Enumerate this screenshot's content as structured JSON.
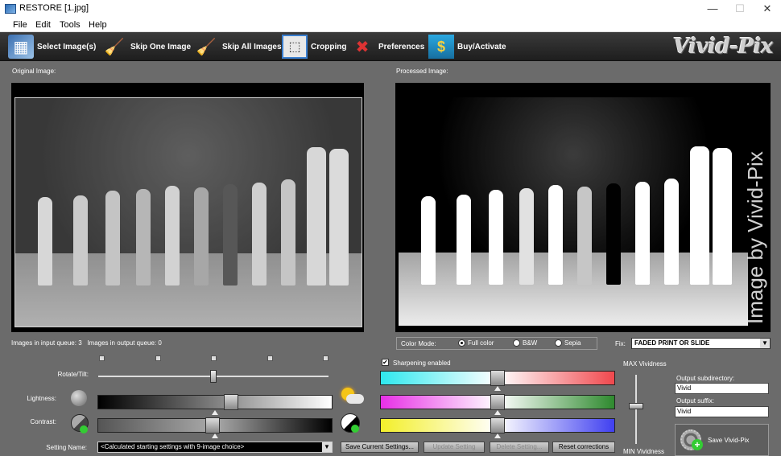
{
  "window": {
    "title": "RESTORE  [1.jpg]",
    "minimize": "—",
    "maximize": "☐",
    "close": "✕"
  },
  "menu": [
    "File",
    "Edit",
    "Tools",
    "Help"
  ],
  "toolbar": {
    "select_images": "Select Image(s)",
    "skip_one": "Skip One Image",
    "skip_all": "Skip All Images",
    "cropping": "Cropping",
    "preferences": "Preferences",
    "buy": "Buy/Activate",
    "logo": "Vivid-Pix"
  },
  "panels": {
    "original_label": "Original Image:",
    "processed_label": "Processed Image:",
    "watermark": "Image by Vivid-Pix"
  },
  "queue": {
    "input_label": "Images in input queue:",
    "input_count": "3",
    "output_label": "Images in output queue:",
    "output_count": "0"
  },
  "adjust": {
    "rotate_label": "Rotate/Tilt:",
    "lightness_label": "Lightness:",
    "contrast_label": "Contrast:",
    "rotate_value": 0.5,
    "lightness_value": 0.57,
    "contrast_value": 0.49
  },
  "setting": {
    "label": "Setting Name:",
    "value": "<Calculated starting settings with 9-image choice>",
    "save": "Save Current Settings...",
    "update": "Update Setting",
    "delete": "Delete Setting...",
    "reset": "Reset corrections"
  },
  "color_mode": {
    "label": "Color Mode:",
    "options": [
      "Full color",
      "B&W",
      "Sepia"
    ],
    "selected": "Full color"
  },
  "fix": {
    "label": "Fix:",
    "value": "FADED PRINT OR SLIDE"
  },
  "sharpening": {
    "label": "Sharpening enabled",
    "checked": "✔"
  },
  "color_balance": {
    "cyan_red": 0.5,
    "magenta_green": 0.5,
    "yellow_blue": 0.5
  },
  "vividness": {
    "max_label": "MAX Vividness",
    "min_label": "MIN Vividness",
    "value": 0.55
  },
  "output": {
    "subdir_label": "Output subdirectory:",
    "subdir_value": "Vivid",
    "suffix_label": "Output suffix:",
    "suffix_value": "Vivid",
    "save_button": "Save Vivid-Pix"
  },
  "colors": {
    "cyan": "#2ee8ee",
    "red": "#f0484d",
    "magenta": "#e72fe6",
    "green": "#2e8a2e",
    "yellow": "#f3ef2a",
    "blue": "#4040f0"
  }
}
